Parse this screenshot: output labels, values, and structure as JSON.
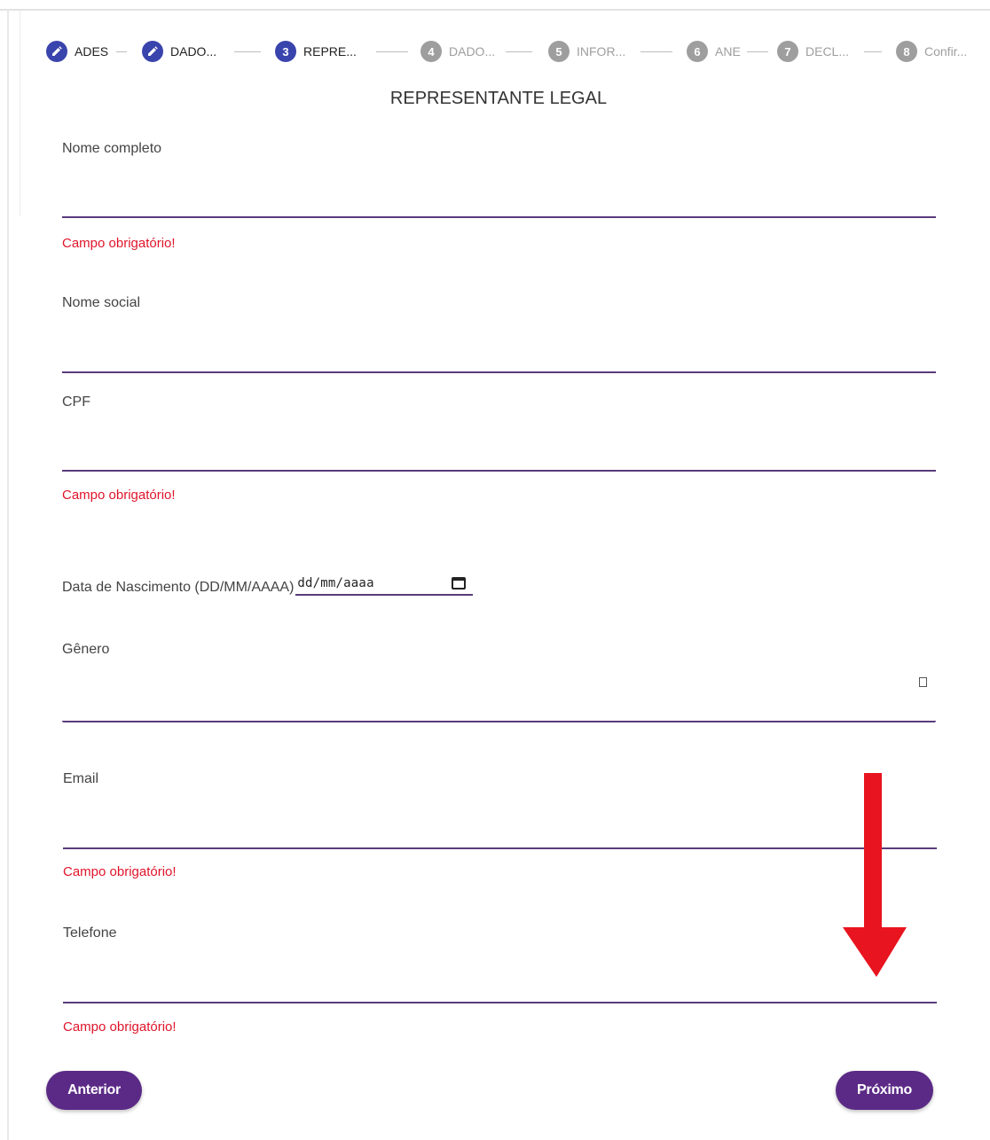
{
  "stepper": {
    "steps": [
      {
        "number": "",
        "label": "ADES",
        "state": "done-edit"
      },
      {
        "number": "",
        "label": "DADO...",
        "state": "done-edit"
      },
      {
        "number": "3",
        "label": "REPRE...",
        "state": "active"
      },
      {
        "number": "4",
        "label": "DADO...",
        "state": "inactive"
      },
      {
        "number": "5",
        "label": "INFOR...",
        "state": "inactive"
      },
      {
        "number": "6",
        "label": "ANE",
        "state": "inactive"
      },
      {
        "number": "7",
        "label": "DECL...",
        "state": "inactive"
      },
      {
        "number": "8",
        "label": "Confir...",
        "state": "inactive"
      }
    ],
    "active_color": "#3a44ad",
    "inactive_color": "#9e9e9e"
  },
  "form": {
    "title": "REPRESENTANTE LEGAL",
    "nome_completo": {
      "label": "Nome completo",
      "value": "",
      "error": "Campo obrigatório!"
    },
    "nome_social": {
      "label": "Nome social",
      "value": ""
    },
    "cpf": {
      "label": "CPF",
      "value": "",
      "error": "Campo obrigatório!"
    },
    "data_nascimento": {
      "label": "Data de Nascimento (DD/MM/AAAA)",
      "value": "dd/mm/aaaa"
    },
    "genero": {
      "label": "Gênero",
      "value": ""
    },
    "email": {
      "label": "Email",
      "value": "",
      "error": "Campo obrigatório!"
    },
    "telefone": {
      "label": "Telefone",
      "value": "",
      "error": "Campo obrigatório!"
    }
  },
  "buttons": {
    "previous": "Anterior",
    "next": "Próximo"
  },
  "colors": {
    "underline": "#5a3b7c",
    "error": "#e0142a",
    "button": "#5b2a86",
    "annotation_arrow": "#e8141f"
  }
}
